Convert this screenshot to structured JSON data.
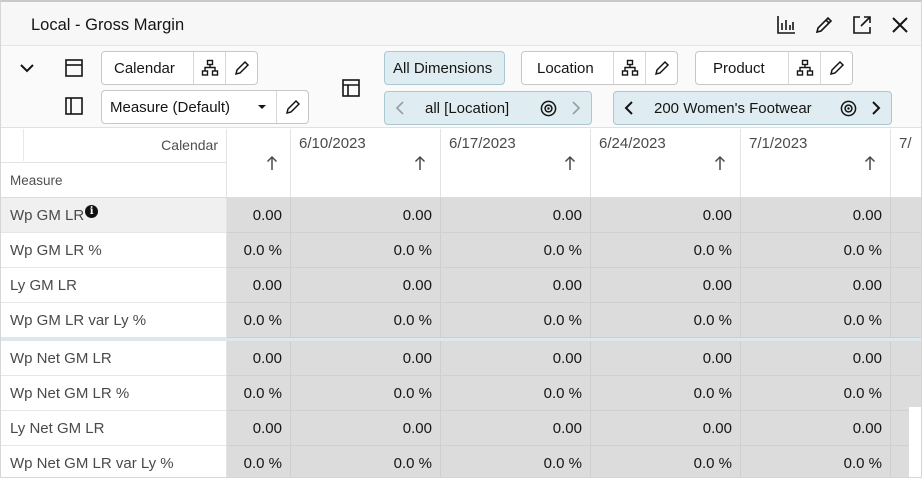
{
  "window": {
    "title": "Local - Gross Margin",
    "icons": [
      "chart-icon",
      "edit-icon",
      "expand-icon",
      "close-icon"
    ]
  },
  "toolbar": {
    "calendar_label": "Calendar",
    "measure_label": "Measure (Default)",
    "all_dimensions_label": "All Dimensions",
    "location_label": "Location",
    "product_label": "Product",
    "location_value": "all [Location]",
    "product_value": "200 Women's Footwear"
  },
  "grid": {
    "calendar_header": "Calendar",
    "measure_header": "Measure",
    "columns": [
      "",
      "6/10/2023",
      "6/17/2023",
      "6/24/2023",
      "7/1/2023",
      "7/"
    ],
    "rows": [
      {
        "name": "Wp GM LR",
        "values": [
          "0.00",
          "0.00",
          "0.00",
          "0.00",
          "0.00"
        ]
      },
      {
        "name": "Wp GM LR %",
        "values": [
          "0.0 %",
          "0.0 %",
          "0.0 %",
          "0.0 %",
          "0.0 %"
        ]
      },
      {
        "name": "Ly GM LR",
        "values": [
          "0.00",
          "0.00",
          "0.00",
          "0.00",
          "0.00"
        ]
      },
      {
        "name": "Wp GM LR var Ly %",
        "values": [
          "0.0 %",
          "0.0 %",
          "0.0 %",
          "0.0 %",
          "0.0 %"
        ]
      },
      {
        "name": "Wp Net GM LR",
        "values": [
          "0.00",
          "0.00",
          "0.00",
          "0.00",
          "0.00"
        ]
      },
      {
        "name": "Wp Net GM LR %",
        "values": [
          "0.0 %",
          "0.0 %",
          "0.0 %",
          "0.0 %",
          "0.0 %"
        ]
      },
      {
        "name": "Ly Net GM LR",
        "values": [
          "0.00",
          "0.00",
          "0.00",
          "0.00",
          "0.00"
        ]
      },
      {
        "name": "Wp Net GM LR var Ly %",
        "values": [
          "0.0 %",
          "0.0 %",
          "0.0 %",
          "0.0 %",
          "0.0 %"
        ]
      }
    ],
    "info_marker": "i"
  },
  "colors": {
    "accent_teal": "#dfedf2",
    "cell_gray": "#dcdcdc",
    "text": "#161513"
  }
}
